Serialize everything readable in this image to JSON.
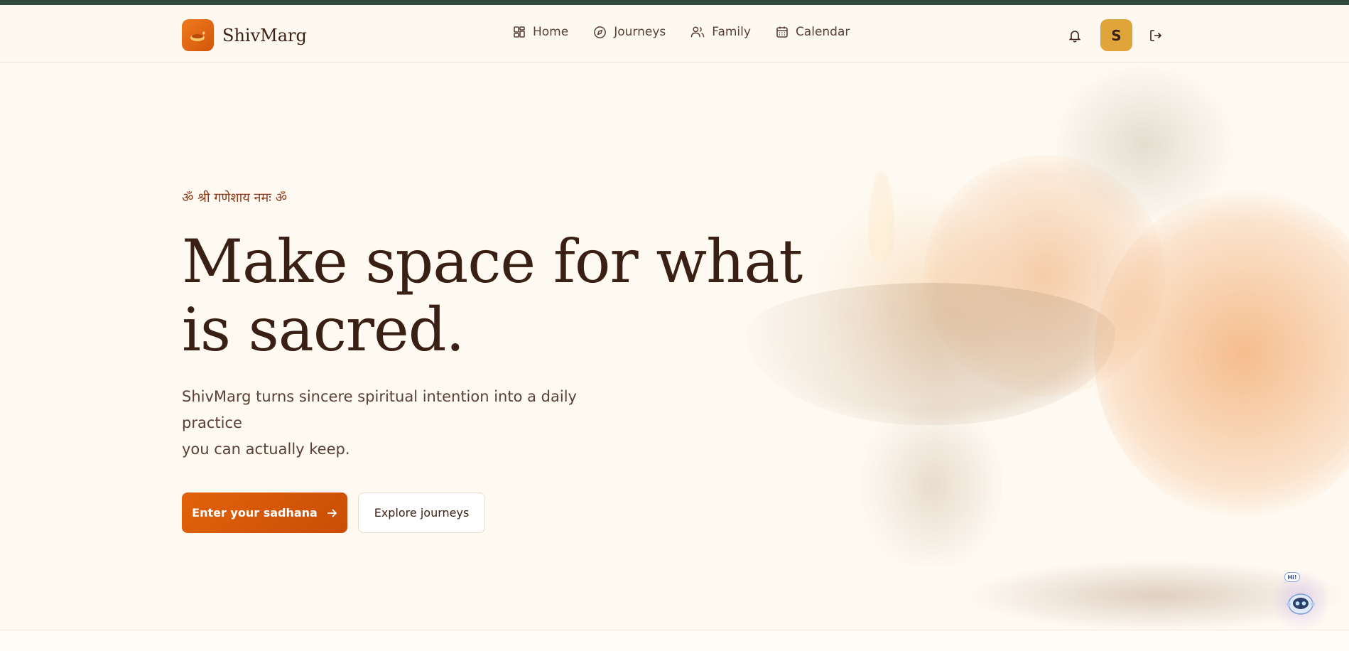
{
  "brand": {
    "name": "ShivMarg",
    "logo_icon": "diya-lamp-icon"
  },
  "nav": {
    "items": [
      {
        "label": "Home",
        "icon": "grid-icon"
      },
      {
        "label": "Journeys",
        "icon": "compass-icon"
      },
      {
        "label": "Family",
        "icon": "users-icon"
      },
      {
        "label": "Calendar",
        "icon": "calendar-icon"
      }
    ]
  },
  "header_actions": {
    "avatar_initial": "S",
    "bell_icon": "bell-icon",
    "logout_icon": "logout-icon"
  },
  "hero": {
    "mantra": "ॐ श्री गणेशाय नमः ॐ",
    "headline_line1": "Make space for what",
    "headline_line2": "is sacred.",
    "subtitle_line1": "ShivMarg turns sincere spiritual intention into a daily practice",
    "subtitle_line2": "you can actually keep.",
    "primary_cta": "Enter your sadhana",
    "secondary_cta": "Explore journeys"
  },
  "assistant": {
    "bubble": "Hi!"
  },
  "colors": {
    "accent": "#e2620b",
    "avatar_bg": "#e0a53a",
    "topbar": "#2f4a3f",
    "text_dark": "#3a1f14",
    "background": "#fef9f1"
  }
}
